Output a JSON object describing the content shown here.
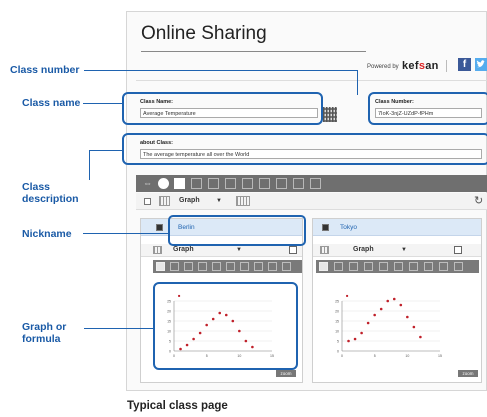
{
  "screen": {
    "title": "Online Sharing",
    "powered_by": "Powered by",
    "brand_pre": "kef",
    "brand_accent": "s",
    "brand_post": "an",
    "facebook_label": "f",
    "class_name_label": "Class Name:",
    "class_name_value": "Average Temperature",
    "class_number_label": "Class Number:",
    "class_number_value": "7IoK-3njZ-UZdP-fPHm",
    "about_label": "about Class:",
    "about_value": "The average temperature all over the World",
    "toolbar_graph_label": "Graph",
    "panels": [
      {
        "nickname": "Berlin",
        "graph_label": "Graph",
        "zoom_label": "zoom"
      },
      {
        "nickname": "Tokyo",
        "graph_label": "Graph",
        "zoom_label": "zoom"
      }
    ],
    "plot": {
      "y_ticks": [
        "25",
        "20",
        "15",
        "10",
        "5",
        "0"
      ],
      "x_ticks": [
        "0",
        "5",
        "10",
        "15"
      ],
      "legend": "■"
    }
  },
  "annotations": {
    "class_number": "Class number",
    "class_name": "Class name",
    "class_description_line1": "Class",
    "class_description_line2": "description",
    "nickname": "Nickname",
    "graph_line1": "Graph or",
    "graph_line2": "formula"
  },
  "caption": "Typical class page",
  "colors": {
    "annotation": "#1a5aa6",
    "highlight": "#1f63b0",
    "toolbar": "#6f6f6f",
    "point": "#c0202a"
  },
  "chart_series": {
    "berlin_points": [
      [
        1,
        1
      ],
      [
        2,
        3
      ],
      [
        3,
        6
      ],
      [
        4,
        9
      ],
      [
        5,
        13
      ],
      [
        6,
        16
      ],
      [
        7,
        19
      ],
      [
        8,
        18
      ],
      [
        9,
        15
      ],
      [
        10,
        10
      ],
      [
        11,
        5
      ],
      [
        12,
        2
      ]
    ],
    "tokyo_points": [
      [
        1,
        5
      ],
      [
        2,
        6
      ],
      [
        3,
        9
      ],
      [
        4,
        14
      ],
      [
        5,
        18
      ],
      [
        6,
        21
      ],
      [
        7,
        25
      ],
      [
        8,
        26
      ],
      [
        9,
        23
      ],
      [
        10,
        17
      ],
      [
        11,
        12
      ],
      [
        12,
        7
      ]
    ]
  }
}
